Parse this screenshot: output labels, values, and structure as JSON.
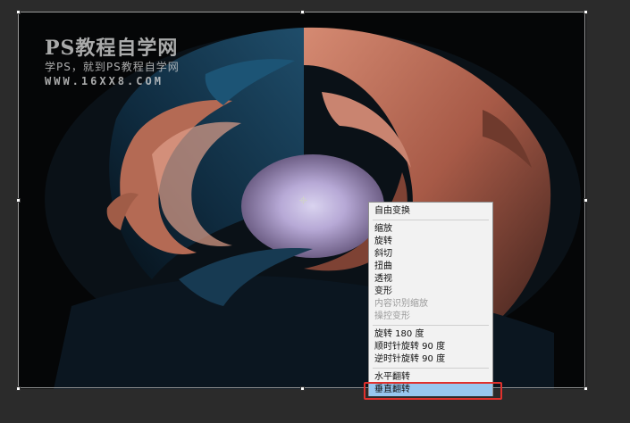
{
  "watermark": {
    "title": "PS教程自学网",
    "subtitle": "学PS，就到PS教程自学网",
    "url": "WWW.16XX8.COM"
  },
  "context_menu": {
    "items": [
      {
        "label": "自由变换",
        "enabled": true
      },
      {
        "separator": true
      },
      {
        "label": "缩放",
        "enabled": true
      },
      {
        "label": "旋转",
        "enabled": true
      },
      {
        "label": "斜切",
        "enabled": true
      },
      {
        "label": "扭曲",
        "enabled": true
      },
      {
        "label": "透视",
        "enabled": true
      },
      {
        "label": "变形",
        "enabled": true
      },
      {
        "label": "内容识别缩放",
        "enabled": false
      },
      {
        "label": "操控变形",
        "enabled": false
      },
      {
        "separator": true
      },
      {
        "label": "旋转 180 度",
        "enabled": true
      },
      {
        "label": "顺时针旋转 90 度",
        "enabled": true
      },
      {
        "label": "逆时针旋转 90 度",
        "enabled": true
      },
      {
        "separator": true
      },
      {
        "label": "水平翻转",
        "enabled": true
      },
      {
        "label": "垂直翻转",
        "enabled": true,
        "selected": true
      }
    ]
  },
  "colors": {
    "highlight_box": "#e0312d",
    "selected_bg": "#98c7ef"
  }
}
